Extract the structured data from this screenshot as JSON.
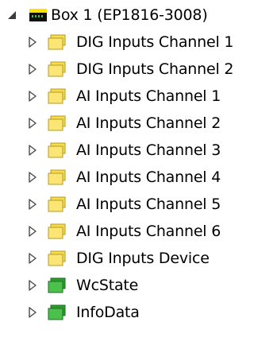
{
  "tree": {
    "root": {
      "label": "Box 1 (EP1816-3008)",
      "expanded": true,
      "icon": "terminal-box-icon"
    },
    "children": [
      {
        "label": "DIG Inputs Channel 1",
        "icon": "folder-icon",
        "color": "#f0d040"
      },
      {
        "label": "DIG Inputs Channel 2",
        "icon": "folder-icon",
        "color": "#f0d040"
      },
      {
        "label": "AI Inputs Channel 1",
        "icon": "folder-icon",
        "color": "#f0d040"
      },
      {
        "label": "AI Inputs Channel 2",
        "icon": "folder-icon",
        "color": "#f0d040"
      },
      {
        "label": "AI Inputs Channel 3",
        "icon": "folder-icon",
        "color": "#f0d040"
      },
      {
        "label": "AI Inputs Channel 4",
        "icon": "folder-icon",
        "color": "#f0d040"
      },
      {
        "label": "AI Inputs Channel 5",
        "icon": "folder-icon",
        "color": "#f0d040"
      },
      {
        "label": "AI Inputs Channel 6",
        "icon": "folder-icon",
        "color": "#f0d040"
      },
      {
        "label": "DIG Inputs Device",
        "icon": "folder-icon",
        "color": "#f0d040"
      },
      {
        "label": "WcState",
        "icon": "green-block-icon",
        "color": "#3aa93a"
      },
      {
        "label": "InfoData",
        "icon": "green-block-icon",
        "color": "#3aa93a"
      }
    ]
  }
}
